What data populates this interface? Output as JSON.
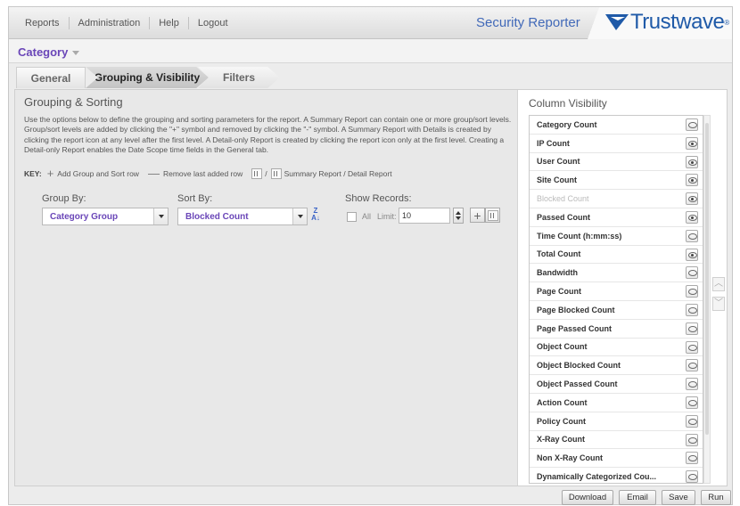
{
  "nav": {
    "items": [
      "Reports",
      "Administration",
      "Help",
      "Logout"
    ]
  },
  "product_name": "Security Reporter",
  "logo": {
    "text": "Trustwave",
    "mark": "®"
  },
  "category": {
    "label": "Category"
  },
  "tabs": [
    "General",
    "Grouping & Visibility",
    "Filters"
  ],
  "grouping": {
    "title": "Grouping & Sorting",
    "description": "Use the options below to define the grouping and sorting parameters for the report. A Summary Report can contain one or more group/sort levels. Group/sort levels are added by clicking the \"+\" symbol and removed by clicking the \"-\" symbol. A Summary Report with Details is created by clicking the report icon at any level after the first level. A Detail-only Report is created by clicking the report icon only at the first level. Creating a Detail-only Report enables the Date Scope time fields in the General tab.",
    "key": {
      "label": "KEY:",
      "add": "Add Group and Sort row",
      "remove": "Remove last added row",
      "slash": "/",
      "report": "Summary Report / Detail Report"
    },
    "group_by_label": "Group By:",
    "sort_by_label": "Sort By:",
    "show_records_label": "Show Records:",
    "group_by_value": "Category Group",
    "sort_by_value": "Blocked Count",
    "sort_icon_top": "Z",
    "sort_icon_bottom": "A↓",
    "all_label": "All",
    "limit_label": "Limit:",
    "limit_value": "10"
  },
  "visibility": {
    "title": "Column Visibility",
    "items": [
      {
        "label": "Category Count",
        "visible": false,
        "enabled": true
      },
      {
        "label": "IP Count",
        "visible": true,
        "enabled": true
      },
      {
        "label": "User Count",
        "visible": true,
        "enabled": true
      },
      {
        "label": "Site Count",
        "visible": true,
        "enabled": true
      },
      {
        "label": "Blocked Count",
        "visible": true,
        "enabled": false
      },
      {
        "label": "Passed Count",
        "visible": true,
        "enabled": true
      },
      {
        "label": "Time Count (h:mm:ss)",
        "visible": false,
        "enabled": true
      },
      {
        "label": "Total Count",
        "visible": true,
        "enabled": true
      },
      {
        "label": "Bandwidth",
        "visible": false,
        "enabled": true
      },
      {
        "label": "Page Count",
        "visible": false,
        "enabled": true
      },
      {
        "label": "Page Blocked Count",
        "visible": false,
        "enabled": true
      },
      {
        "label": "Page Passed Count",
        "visible": false,
        "enabled": true
      },
      {
        "label": "Object Count",
        "visible": false,
        "enabled": true
      },
      {
        "label": "Object Blocked Count",
        "visible": false,
        "enabled": true
      },
      {
        "label": "Object Passed Count",
        "visible": false,
        "enabled": true
      },
      {
        "label": "Action Count",
        "visible": false,
        "enabled": true
      },
      {
        "label": "Policy Count",
        "visible": false,
        "enabled": true
      },
      {
        "label": "X-Ray Count",
        "visible": false,
        "enabled": true
      },
      {
        "label": "Non X-Ray Count",
        "visible": false,
        "enabled": true
      },
      {
        "label": "Dynamically Categorized Cou...",
        "visible": false,
        "enabled": true
      }
    ]
  },
  "footer": {
    "buttons": [
      "Download",
      "Email",
      "Save",
      "Run"
    ]
  },
  "colors": {
    "brand": "#1f5aa8",
    "accent": "#6a46b8",
    "product": "#4169b8"
  },
  "icons": [
    "trustwave-logo-icon",
    "caret-down-icon",
    "plus-icon",
    "minus-icon",
    "report-icon",
    "sort-az-icon",
    "spinner-icon",
    "eye-icon",
    "chevron-up-icon",
    "chevron-down-icon"
  ]
}
